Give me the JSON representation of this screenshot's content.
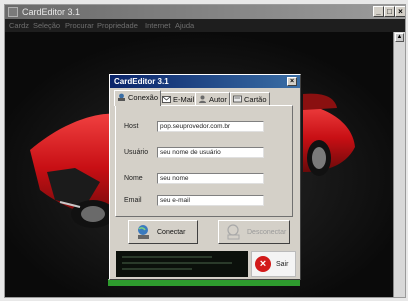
{
  "main_window": {
    "title": "CardEditor 3.1",
    "controls": {
      "minimize": "_",
      "maximize": "□",
      "close": "×"
    },
    "menu": [
      "Cardz",
      "Seleção",
      "Procurar",
      "Propriedade",
      "Internet",
      "Ajuda"
    ]
  },
  "dialog": {
    "title": "CardEditor 3.1",
    "close": "×",
    "tabs": [
      {
        "label": "Conexão",
        "icon": "connection-icon",
        "active": true
      },
      {
        "label": "E-Mail",
        "icon": "email-icon",
        "active": false
      },
      {
        "label": "Autor",
        "icon": "author-icon",
        "active": false
      },
      {
        "label": "Cartão",
        "icon": "card-icon",
        "active": false
      }
    ],
    "fields": [
      {
        "label": "Host",
        "value": "pop.seuprovedor.com.br"
      },
      {
        "label": "Usuário",
        "value": "seu nome de usuário"
      },
      {
        "label": "Nome",
        "value": "seu nome"
      },
      {
        "label": "Email",
        "value": "seu e-mail"
      }
    ],
    "buttons": {
      "connect": "Conectar",
      "disconnect": "Desconectar",
      "exit": "Sair"
    }
  },
  "colors": {
    "dialog_titlebar": "#0a246a",
    "car_body": "#d4141a",
    "exit_icon": "#d21a1a",
    "progress_green": "#2e9b2e"
  }
}
